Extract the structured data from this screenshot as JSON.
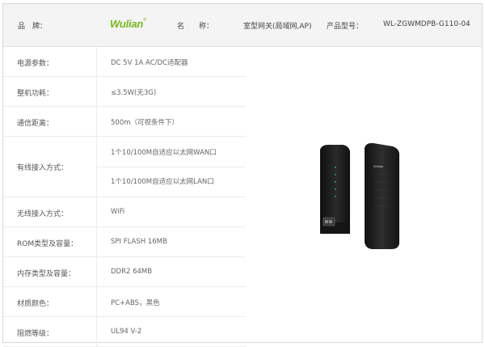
{
  "header": {
    "brand_label": "品　牌：",
    "brand_logo": "Wulian",
    "brand_mark": "®",
    "name_label": "名　　称：",
    "name_value": "室型网关(局域网,AP)",
    "model_label": "产品型号：",
    "model_value": "WL-ZGWMDPB-G110-04"
  },
  "specs": [
    {
      "label": "电源参数：",
      "value": "DC 5V 1A AC/DC适配器"
    },
    {
      "label": "整机功耗：",
      "value": "≤3.5W(无3G)"
    },
    {
      "label": "通信距离：",
      "value": "500m（可视条件下）"
    },
    {
      "label": "有线接入方式：",
      "values": [
        "1个10/100M自适应以太网WAN口",
        "1个10/100M自适应以太网LAN口"
      ]
    },
    {
      "label": "无线接入方式：",
      "value": "WiFi"
    },
    {
      "label": "ROM类型及容量：",
      "value": "SPI FLASH 16MB"
    },
    {
      "label": "内存类型及容量：",
      "value": "DDR2 64MB"
    },
    {
      "label": "材质颜色：",
      "value": "PC+ABS，黑色"
    },
    {
      "label": "阻燃等级：",
      "value": "UL94 V-2"
    }
  ],
  "product_image": {
    "device_label": "Wulian",
    "colors": {
      "body": "#1c1c1c",
      "accent": "#3fbf9f",
      "brand": "#7ab51d"
    }
  }
}
